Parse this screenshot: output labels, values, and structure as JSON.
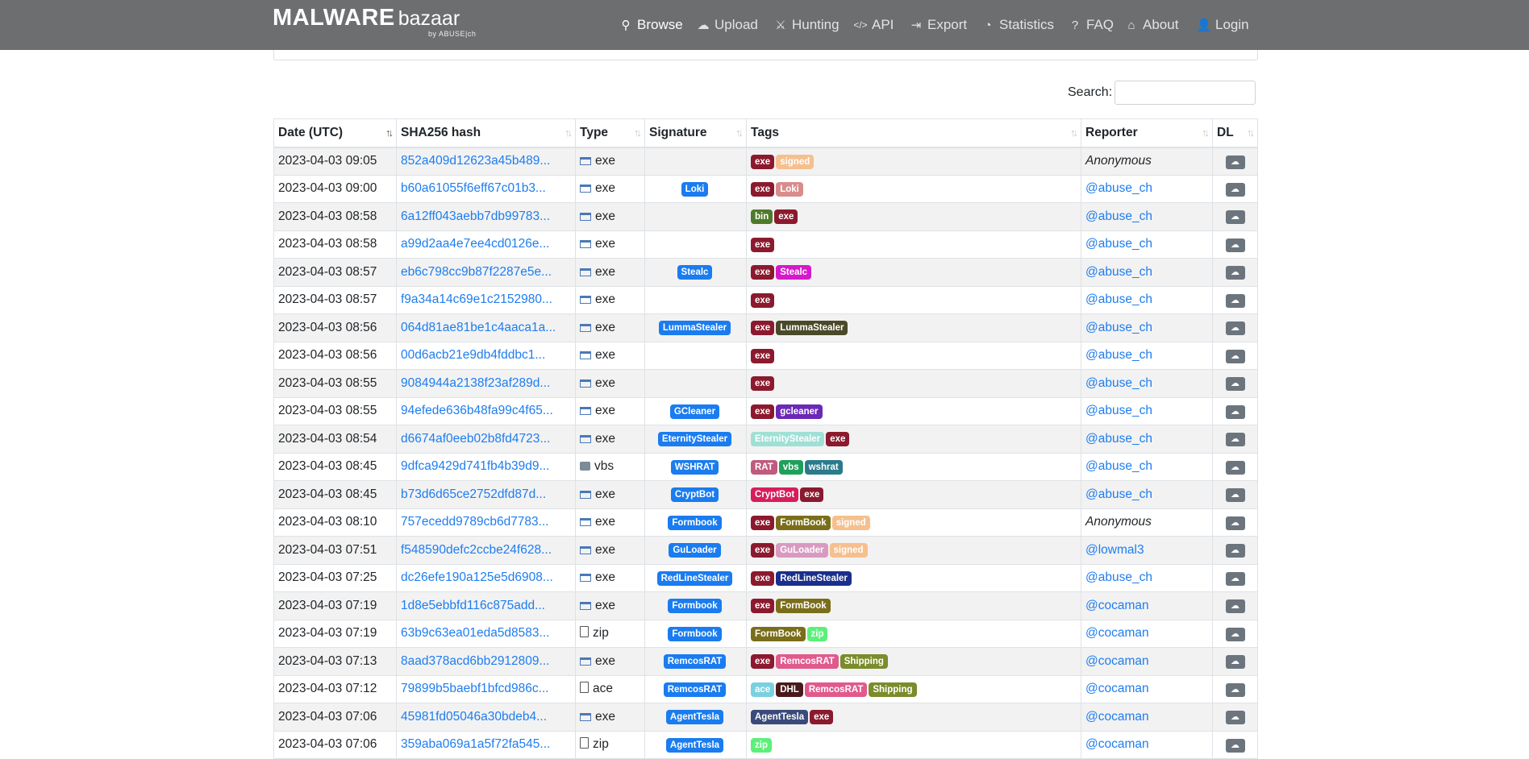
{
  "brand": {
    "name": "MALWARE",
    "sub": "bazaar",
    "by": "by ABUSE|ch"
  },
  "nav": [
    {
      "label": "Browse",
      "icon": "search-icon",
      "active": true
    },
    {
      "label": "Upload",
      "icon": "cloud-upload-icon"
    },
    {
      "label": "Hunting",
      "icon": "hunting-icon"
    },
    {
      "label": "API",
      "icon": "code-icon"
    },
    {
      "label": "Export",
      "icon": "export-icon"
    },
    {
      "label": "Statistics",
      "icon": "pie-chart-icon"
    },
    {
      "label": "FAQ",
      "icon": "question-icon"
    },
    {
      "label": "About",
      "icon": "building-icon"
    },
    {
      "label": "Login",
      "icon": "user-icon"
    }
  ],
  "search": {
    "label": "Search:",
    "value": ""
  },
  "columns": [
    "Date (UTC)",
    "SHA256 hash",
    "Type",
    "Signature",
    "Tags",
    "Reporter",
    "DL"
  ],
  "rows": [
    {
      "date": "2023-04-03 09:05",
      "hash": "852a409d12623a45b489...",
      "type": "exe",
      "sig": "",
      "tags": [
        [
          "exe",
          "#8b1a2e"
        ],
        [
          "signed",
          "#f5c08e"
        ]
      ],
      "reporter": "Anonymous"
    },
    {
      "date": "2023-04-03 09:00",
      "hash": "b60a61055f6eff67c01b3...",
      "type": "exe",
      "sig": "Loki",
      "tags": [
        [
          "exe",
          "#8b1a2e"
        ],
        [
          "Loki",
          "#d98c8c"
        ]
      ],
      "reporter": "@abuse_ch"
    },
    {
      "date": "2023-04-03 08:58",
      "hash": "6a12ff043aebb7db99783...",
      "type": "exe",
      "sig": "",
      "tags": [
        [
          "bin",
          "#4f7a2b"
        ],
        [
          "exe",
          "#8b1a2e"
        ]
      ],
      "reporter": "@abuse_ch"
    },
    {
      "date": "2023-04-03 08:58",
      "hash": "a99d2aa4e7ee4cd0126e...",
      "type": "exe",
      "sig": "",
      "tags": [
        [
          "exe",
          "#8b1a2e"
        ]
      ],
      "reporter": "@abuse_ch"
    },
    {
      "date": "2023-04-03 08:57",
      "hash": "eb6c798cc9b87f2287e5e...",
      "type": "exe",
      "sig": "Stealc",
      "tags": [
        [
          "exe",
          "#8b1a2e"
        ],
        [
          "Stealc",
          "#d619c9"
        ]
      ],
      "reporter": "@abuse_ch"
    },
    {
      "date": "2023-04-03 08:57",
      "hash": "f9a34a14c69e1c2152980...",
      "type": "exe",
      "sig": "",
      "tags": [
        [
          "exe",
          "#8b1a2e"
        ]
      ],
      "reporter": "@abuse_ch"
    },
    {
      "date": "2023-04-03 08:56",
      "hash": "064d81ae81be1c4aaca1a...",
      "type": "exe",
      "sig": "LummaStealer",
      "tags": [
        [
          "exe",
          "#8b1a2e"
        ],
        [
          "LummaStealer",
          "#4a4a2a"
        ]
      ],
      "reporter": "@abuse_ch"
    },
    {
      "date": "2023-04-03 08:56",
      "hash": "00d6acb21e9db4fddbc1...",
      "type": "exe",
      "sig": "",
      "tags": [
        [
          "exe",
          "#8b1a2e"
        ]
      ],
      "reporter": "@abuse_ch"
    },
    {
      "date": "2023-04-03 08:55",
      "hash": "9084944a2138f23af289d...",
      "type": "exe",
      "sig": "",
      "tags": [
        [
          "exe",
          "#8b1a2e"
        ]
      ],
      "reporter": "@abuse_ch"
    },
    {
      "date": "2023-04-03 08:55",
      "hash": "94efede636b48fa99c4f65...",
      "type": "exe",
      "sig": "GCleaner",
      "tags": [
        [
          "exe",
          "#8b1a2e"
        ],
        [
          "gcleaner",
          "#6a2ab5"
        ]
      ],
      "reporter": "@abuse_ch"
    },
    {
      "date": "2023-04-03 08:54",
      "hash": "d6674af0eeb02b8fd4723...",
      "type": "exe",
      "sig": "EternityStealer",
      "tags": [
        [
          "EternityStealer",
          "#9fe0d6"
        ],
        [
          "exe",
          "#8b1a2e"
        ]
      ],
      "reporter": "@abuse_ch"
    },
    {
      "date": "2023-04-03 08:45",
      "hash": "9dfca9429d741fb4b39d9...",
      "type": "vbs",
      "sig": "WSHRAT",
      "tags": [
        [
          "RAT",
          "#c05b7d"
        ],
        [
          "vbs",
          "#1ea05a"
        ],
        [
          "wshrat",
          "#2b7a8c"
        ]
      ],
      "reporter": "@abuse_ch"
    },
    {
      "date": "2023-04-03 08:45",
      "hash": "b73d6d65ce2752dfd87d...",
      "type": "exe",
      "sig": "CryptBot",
      "tags": [
        [
          "CryptBot",
          "#d61e5c"
        ],
        [
          "exe",
          "#8b1a2e"
        ]
      ],
      "reporter": "@abuse_ch"
    },
    {
      "date": "2023-04-03 08:10",
      "hash": "757ecedd9789cb6d7783...",
      "type": "exe",
      "sig": "Formbook",
      "tags": [
        [
          "exe",
          "#8b1a2e"
        ],
        [
          "FormBook",
          "#7a6e1a"
        ],
        [
          "signed",
          "#f5c08e"
        ]
      ],
      "reporter": "Anonymous"
    },
    {
      "date": "2023-04-03 07:51",
      "hash": "f548590defc2ccbe24f628...",
      "type": "exe",
      "sig": "GuLoader",
      "tags": [
        [
          "exe",
          "#8b1a2e"
        ],
        [
          "GuLoader",
          "#d99ac0"
        ],
        [
          "signed",
          "#f5c08e"
        ]
      ],
      "reporter": "@lowmal3"
    },
    {
      "date": "2023-04-03 07:25",
      "hash": "dc26efe190a125e5d6908...",
      "type": "exe",
      "sig": "RedLineStealer",
      "tags": [
        [
          "exe",
          "#8b1a2e"
        ],
        [
          "RedLineStealer",
          "#1a2e8b"
        ]
      ],
      "reporter": "@abuse_ch"
    },
    {
      "date": "2023-04-03 07:19",
      "hash": "1d8e5ebbfd116c875add...",
      "type": "exe",
      "sig": "Formbook",
      "tags": [
        [
          "exe",
          "#8b1a2e"
        ],
        [
          "FormBook",
          "#7a6e1a"
        ]
      ],
      "reporter": "@cocaman"
    },
    {
      "date": "2023-04-03 07:19",
      "hash": "63b9c63ea01eda5d8583...",
      "type": "zip",
      "sig": "Formbook",
      "tags": [
        [
          "FormBook",
          "#7a6e1a"
        ],
        [
          "zip",
          "#5cf07a"
        ]
      ],
      "reporter": "@cocaman"
    },
    {
      "date": "2023-04-03 07:13",
      "hash": "8aad378acd6bb2912809...",
      "type": "exe",
      "sig": "RemcosRAT",
      "tags": [
        [
          "exe",
          "#8b1a2e"
        ],
        [
          "RemcosRAT",
          "#e05a8c"
        ],
        [
          "Shipping",
          "#7a8c2b"
        ]
      ],
      "reporter": "@cocaman"
    },
    {
      "date": "2023-04-03 07:12",
      "hash": "79899b5baebf1bfcd986c...",
      "type": "ace",
      "sig": "RemcosRAT",
      "tags": [
        [
          "ace",
          "#7ad0e0"
        ],
        [
          "DHL",
          "#4a1a1a"
        ],
        [
          "RemcosRAT",
          "#e05a8c"
        ],
        [
          "Shipping",
          "#7a8c2b"
        ]
      ],
      "reporter": "@cocaman"
    },
    {
      "date": "2023-04-03 07:06",
      "hash": "45981fd05046a30bdeb4...",
      "type": "exe",
      "sig": "AgentTesla",
      "tags": [
        [
          "AgentTesla",
          "#3a4a7a"
        ],
        [
          "exe",
          "#8b1a2e"
        ]
      ],
      "reporter": "@cocaman"
    },
    {
      "date": "2023-04-03 07:06",
      "hash": "359aba069a1a5f72fa545...",
      "type": "zip",
      "sig": "AgentTesla",
      "tags": [
        [
          "zip",
          "#5cf07a"
        ]
      ],
      "reporter": "@cocaman"
    }
  ]
}
